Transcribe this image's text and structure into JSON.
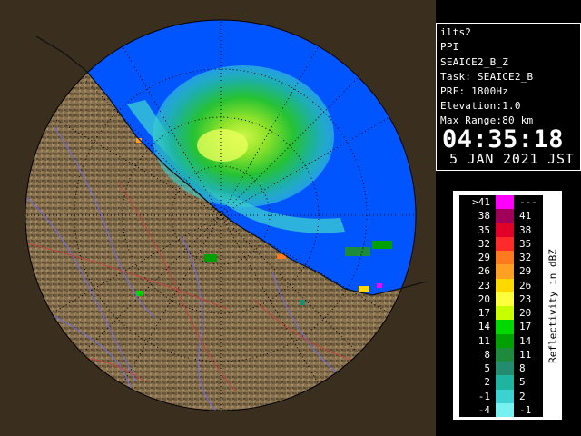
{
  "info": {
    "station": "ilts2",
    "scan_type": "PPI",
    "product": "SEAICE2_B_Z",
    "task": "Task: SEAICE2_B",
    "prf": "PRF: 1800Hz",
    "elevation": "Elevation:1.0",
    "max_range": "Max Range:80 km",
    "time": "04:35:18",
    "date": "5 JAN 2021 JST"
  },
  "legend": {
    "unit_label": "Reflectivity in dBZ",
    "rows": [
      {
        "low": ">41",
        "high": "---",
        "color": "#ff00ff"
      },
      {
        "low": "38",
        "high": "41",
        "color": "#a0005a"
      },
      {
        "low": "35",
        "high": "38",
        "color": "#e00028"
      },
      {
        "low": "32",
        "high": "35",
        "color": "#ff2a2a"
      },
      {
        "low": "29",
        "high": "32",
        "color": "#ff7a1e"
      },
      {
        "low": "26",
        "high": "29",
        "color": "#ffa024"
      },
      {
        "low": "23",
        "high": "26",
        "color": "#ffd800"
      },
      {
        "low": "20",
        "high": "23",
        "color": "#ffff3c"
      },
      {
        "low": "17",
        "high": "20",
        "color": "#c8ff00"
      },
      {
        "low": "14",
        "high": "17",
        "color": "#00d800"
      },
      {
        "low": "11",
        "high": "14",
        "color": "#00a000"
      },
      {
        "low": "8",
        "high": "11",
        "color": "#1e8a3c"
      },
      {
        "low": "5",
        "high": "8",
        "color": "#238c6e"
      },
      {
        "low": "2",
        "high": "5",
        "color": "#1eb4a0"
      },
      {
        "low": "-1",
        "high": "2",
        "color": "#3cd2d2"
      },
      {
        "low": "-4",
        "high": "-1",
        "color": "#78f0f0"
      }
    ]
  },
  "colors": {
    "sea": "#0055ff",
    "land": "#8a7350",
    "background": "#000000",
    "range_rings": "#000000",
    "rivers": "#6c6cff",
    "boundaries": "#c84040"
  }
}
